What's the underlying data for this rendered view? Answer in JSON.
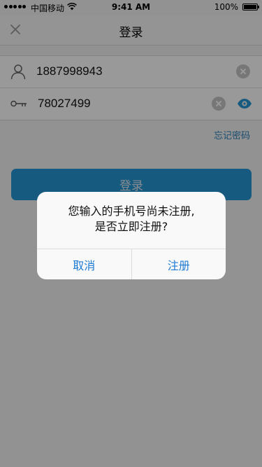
{
  "status_bar": {
    "carrier": "中国移动",
    "time": "9:41 AM",
    "battery": "100%"
  },
  "nav": {
    "title": "登录",
    "close_icon": "close-icon"
  },
  "form": {
    "phone": {
      "value": "1887998943",
      "icon": "user-icon"
    },
    "password": {
      "value": "78027499",
      "icon": "key-icon"
    },
    "forgot_label": "忘记密码",
    "login_label": "登录"
  },
  "dialog": {
    "message_line1": "您输入的手机号尚未注册,",
    "message_line2": "是否立即注册?",
    "cancel_label": "取消",
    "register_label": "注册"
  },
  "colors": {
    "accent": "#2596d6",
    "link": "#1d7ad4"
  }
}
